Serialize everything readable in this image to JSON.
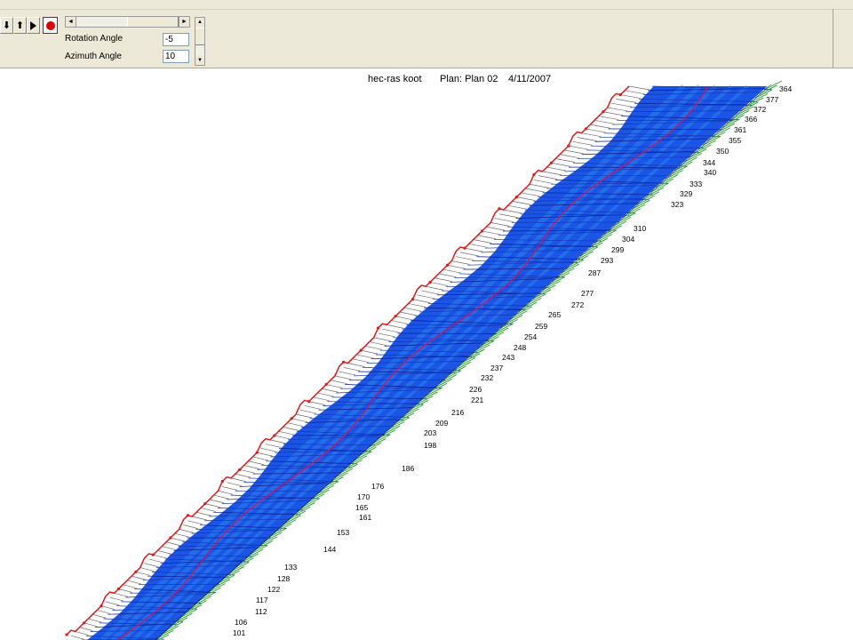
{
  "toolbar": {
    "buttons": [
      {
        "icon": "arrow-down-icon",
        "glyph": "⬇"
      },
      {
        "icon": "arrow-up-icon",
        "glyph": "⬆"
      },
      {
        "icon": "play-step-icon",
        "glyph": "▶"
      },
      {
        "icon": "record-icon",
        "glyph": ""
      }
    ],
    "rotation_label": "Rotation Angle",
    "rotation_value": "-5",
    "azimuth_label": "Azimuth Angle",
    "azimuth_value": "10"
  },
  "plot": {
    "app": "hec-ras koot",
    "plan": "Plan: Plan 02",
    "date": "4/11/2007",
    "colors": {
      "water": "#1a55e6",
      "water_light": "#2f8cf0",
      "bank_left": "#e01818",
      "bank_right": "#1fa01f",
      "channel": "#c0186a"
    },
    "stations": [
      "364",
      "377",
      "372",
      "366",
      "361",
      "355",
      "350",
      "344",
      "340",
      "333",
      "329",
      "323",
      "310",
      "304",
      "299",
      "293",
      "287",
      "277",
      "272",
      "265",
      "259",
      "254",
      "248",
      "243",
      "237",
      "232",
      "226",
      "221",
      "216",
      "209",
      "203",
      "198",
      "186",
      "176",
      "170",
      "165",
      "161",
      "153",
      "144",
      "133",
      "128",
      "122",
      "117",
      "112",
      "106",
      "101"
    ]
  }
}
